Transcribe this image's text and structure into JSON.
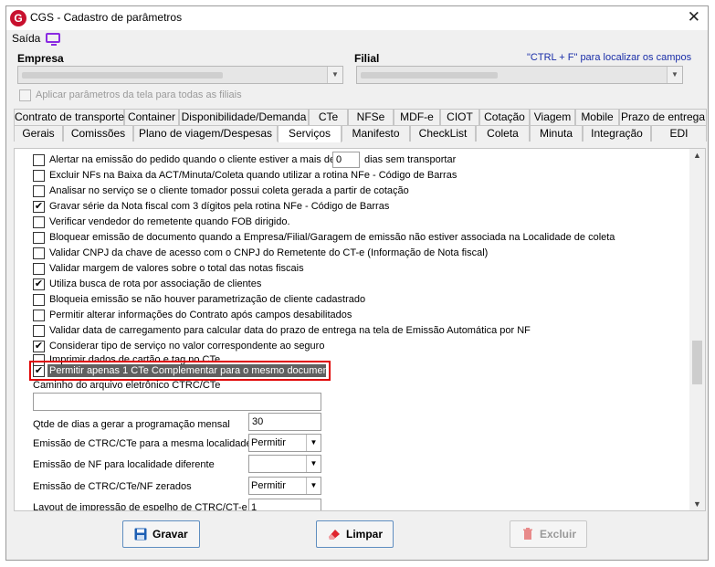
{
  "window": {
    "title": "CGS - Cadastro de parâmetros",
    "close_glyph": "✕",
    "app_icon_letter": "G"
  },
  "menu": {
    "saida": "Saída"
  },
  "empresa": {
    "label": "Empresa"
  },
  "filial": {
    "label": "Filial"
  },
  "hint": "\"CTRL + F\" para localizar os campos",
  "apply_all": {
    "label": "Aplicar parâmetros da tela para todas as filiais",
    "checked": false
  },
  "tabs_row1": [
    "Contrato de transporte",
    "Container",
    "Disponibilidade/Demanda",
    "CTe",
    "NFSe",
    "MDF-e",
    "CIOT",
    "Cotação",
    "Viagem",
    "Mobile",
    "Prazo de entrega"
  ],
  "tabs_row2": [
    "Gerais",
    "Comissões",
    "Plano de viagem/Despesas",
    "Serviços",
    "Manifesto",
    "CheckList",
    "Coleta",
    "Minuta",
    "Integração",
    "EDI"
  ],
  "active_tab": "Serviços",
  "options": [
    {
      "label": "Alertar na emissão do pedido quando o cliente estiver a mais de",
      "checked": false,
      "value": "0",
      "suffix": "dias sem transportar"
    },
    {
      "label": "Excluir NFs na Baixa da ACT/Minuta/Coleta quando utilizar a rotina NFe - Código de Barras",
      "checked": false
    },
    {
      "label": "Analisar no serviço se o cliente tomador possui coleta gerada a partir de cotação",
      "checked": false
    },
    {
      "label": "Gravar série da Nota fiscal com 3 dígitos pela rotina NFe - Código de Barras",
      "checked": true
    },
    {
      "label": "Verificar vendedor do remetente quando FOB dirigido.",
      "checked": false
    },
    {
      "label": "Bloquear emissão de documento quando a Empresa/Filial/Garagem de emissão não estiver associada na Localidade de coleta",
      "checked": false
    },
    {
      "label": "Validar CNPJ da chave de acesso com o CNPJ do Remetente do CT-e (Informação de Nota fiscal)",
      "checked": false
    },
    {
      "label": "Validar margem de valores sobre o total das notas fiscais",
      "checked": false
    },
    {
      "label": "Utiliza busca de rota por associação de clientes",
      "checked": true
    },
    {
      "label": "Bloqueia emissão se não houver parametrização de cliente cadastrado",
      "checked": false
    },
    {
      "label": "Permitir alterar informações do Contrato após campos desabilitados",
      "checked": false
    },
    {
      "label": "Validar data de carregamento para calcular data do prazo de entrega na tela de  Emissão Automática por NF",
      "checked": false
    },
    {
      "label": "Considerar tipo de serviço no valor correspondente ao seguro",
      "checked": true
    },
    {
      "label": "Imprimir dados de cartão e tag no CTe",
      "checked": false
    },
    {
      "label": "Permitir apenas 1 CTe Complementar para o mesmo documento",
      "checked": true
    }
  ],
  "fields": {
    "caminho_label": "Caminho do arquivo eletrônico CTRC/CTe",
    "caminho_value": "",
    "qtde_label": "Qtde de dias a gerar a programação mensal",
    "qtde_value": "30",
    "emissao_mesma_label": "Emissão de CTRC/CTe para a mesma localidade",
    "emissao_mesma_value": "Permitir",
    "emissao_nf_label": "Emissão de NF para localidade diferente",
    "emissao_nf_value": "",
    "emissao_zerados_label": "Emissão de CTRC/CTe/NF zerados",
    "emissao_zerados_value": "Permitir",
    "layout_label": "Layout de impressão de espelho de CTRC/CT-e",
    "layout_value": "1"
  },
  "buttons": {
    "gravar": "Gravar",
    "limpar": "Limpar",
    "excluir": "Excluir"
  },
  "colors": {
    "highlight": "#e00000",
    "hint": "#1a2ea8",
    "accent_purple": "#8a2be2",
    "brand_red": "#c8102e"
  }
}
